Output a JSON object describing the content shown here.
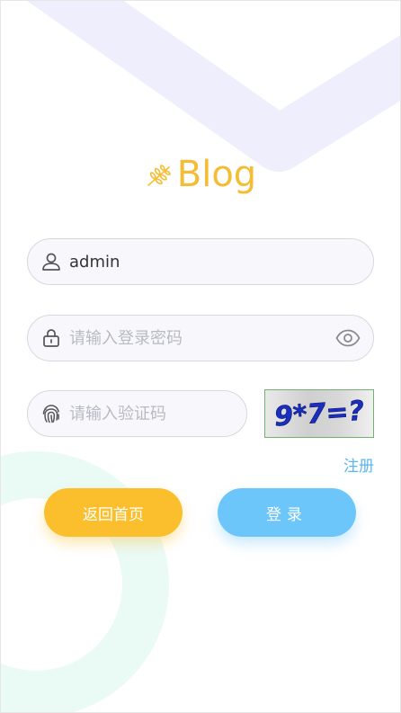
{
  "brand": {
    "logo_text": "Blog",
    "icon": "wheat-icon",
    "color": "#f5bd35"
  },
  "form": {
    "username": {
      "value": "admin",
      "icon": "user-icon"
    },
    "password": {
      "value": "",
      "placeholder": "请输入登录密码",
      "icon": "lock-icon",
      "toggle_icon": "eye-icon"
    },
    "captcha": {
      "value": "",
      "placeholder": "请输入验证码",
      "icon": "fingerprint-icon",
      "image_text": "9*7=?"
    }
  },
  "links": {
    "register": "注册"
  },
  "buttons": {
    "home": "返回首页",
    "login": "登录"
  },
  "colors": {
    "accent_yellow": "#fbbf2d",
    "accent_blue": "#6dc6fa",
    "link_blue": "#5bb6ec",
    "field_bg": "#f8f8fc",
    "field_border": "#d7d7e0",
    "bg_purple": "#eeeefc",
    "bg_mint": "#eafaf5"
  }
}
